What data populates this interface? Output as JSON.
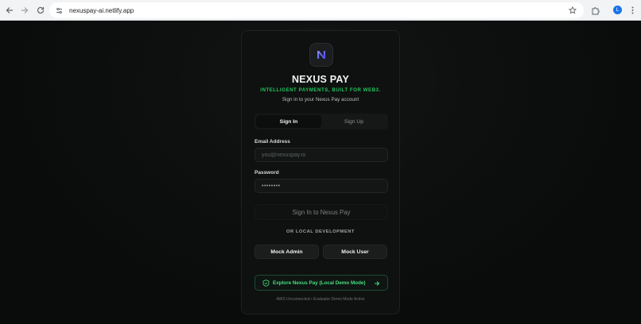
{
  "browser": {
    "url": "nexuspay-ai.netlify.app",
    "avatar_initial": "L"
  },
  "brand": {
    "name": "NEXUS PAY",
    "tagline": "INTELLIGENT PAYMENTS, BUILT FOR WEB3.",
    "subtitle": "Sign in to your Nexus Pay account",
    "accent": "#22c55e",
    "logo_color": "#6366f1"
  },
  "tabs": [
    {
      "label": "Sign In",
      "active": true
    },
    {
      "label": "Sign Up",
      "active": false
    }
  ],
  "form": {
    "email_label": "Email Address",
    "email_placeholder": "you@nexuspay.io",
    "password_label": "Password",
    "password_value": "••••••••",
    "submit_label": "Sign In to Nexus Pay"
  },
  "local_dev": {
    "heading": "OR LOCAL DEVELOPMENT",
    "mock_admin": "Mock Admin",
    "mock_user": "Mock User"
  },
  "explore": {
    "label": "Explore Nexus Pay (Local Demo Mode)"
  },
  "footer": {
    "status": "AWS Unconnected • Evaluator Demo Mode Active"
  }
}
